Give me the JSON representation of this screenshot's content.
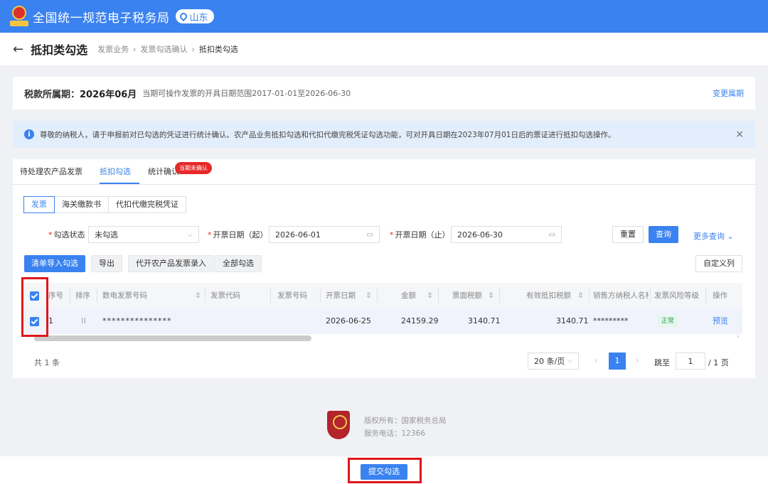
{
  "header": {
    "system_title": "全国统一规范电子税务局",
    "region": "山东"
  },
  "titlebar": {
    "title": "抵扣类勾选",
    "breadcrumb": [
      "发票业务",
      "发票勾选确认",
      "抵扣类勾选"
    ]
  },
  "period": {
    "label": "税款所属期：",
    "value": "2026年06月",
    "range_text": "当期可操作发票的开具日期范围2017-01-01至2026-06-30",
    "change_link": "变更属期"
  },
  "notice": {
    "text": "尊敬的纳税人，请于申报前对已勾选的凭证进行统计确认。农产品业务抵扣勾选和代扣代缴完税凭证勾选功能，可对开具日期在2023年07月01日后的票证进行抵扣勾选操作。"
  },
  "tabs": [
    {
      "label": "待处理农产品发票"
    },
    {
      "label": "抵扣勾选"
    },
    {
      "label": "统计确认"
    }
  ],
  "tab_badge": "当期未确认",
  "subtabs": [
    {
      "label": "发票"
    },
    {
      "label": "海关缴款书"
    },
    {
      "label": "代扣代缴完税凭证"
    }
  ],
  "filters": {
    "status_label": "勾选状态",
    "status_value": "未勾选",
    "date_from_label": "开票日期（起）",
    "date_from_value": "2026-06-01",
    "date_to_label": "开票日期（止）",
    "date_to_value": "2026-06-30",
    "reset": "重置",
    "query": "查询",
    "more": "更多查询"
  },
  "actions": {
    "import_select": "清单导入勾选",
    "export": "导出",
    "agri_entry": "代开农产品发票录入",
    "select_all": "全部勾选",
    "custom_columns": "自定义列"
  },
  "table": {
    "headers": {
      "seq": "序号",
      "sort": "排序",
      "invoice_no": "数电发票号码",
      "invoice_code": "发票代码",
      "invoice_num": "发票号码",
      "issue_date": "开票日期",
      "amount": "金额",
      "face_tax": "票面税额",
      "valid_tax": "有效抵扣税额",
      "seller_id": "销售方纳税人名称",
      "risk": "发票风险等级",
      "op": "操作"
    },
    "rows": [
      {
        "seq": "1",
        "invoice_no": "***************",
        "invoice_code": "",
        "invoice_num": "",
        "issue_date": "2026-06-25",
        "amount": "24159.29",
        "face_tax": "3140.71",
        "valid_tax": "3140.71",
        "seller_id": "*********",
        "risk": "正常",
        "op": "预览"
      }
    ]
  },
  "pagination": {
    "total": "共 1 条",
    "page_size": "20 条/页",
    "current_page": "1",
    "goto_label": "跳至",
    "goto_value": "1",
    "total_pages": "/ 1 页"
  },
  "footer": {
    "copyright": "版权所有：国家税务总局",
    "phone": "服务电话：12366"
  },
  "submit": "提交勾选",
  "colors": {
    "primary": "#3a82f0",
    "highlight": "#e0161b"
  }
}
